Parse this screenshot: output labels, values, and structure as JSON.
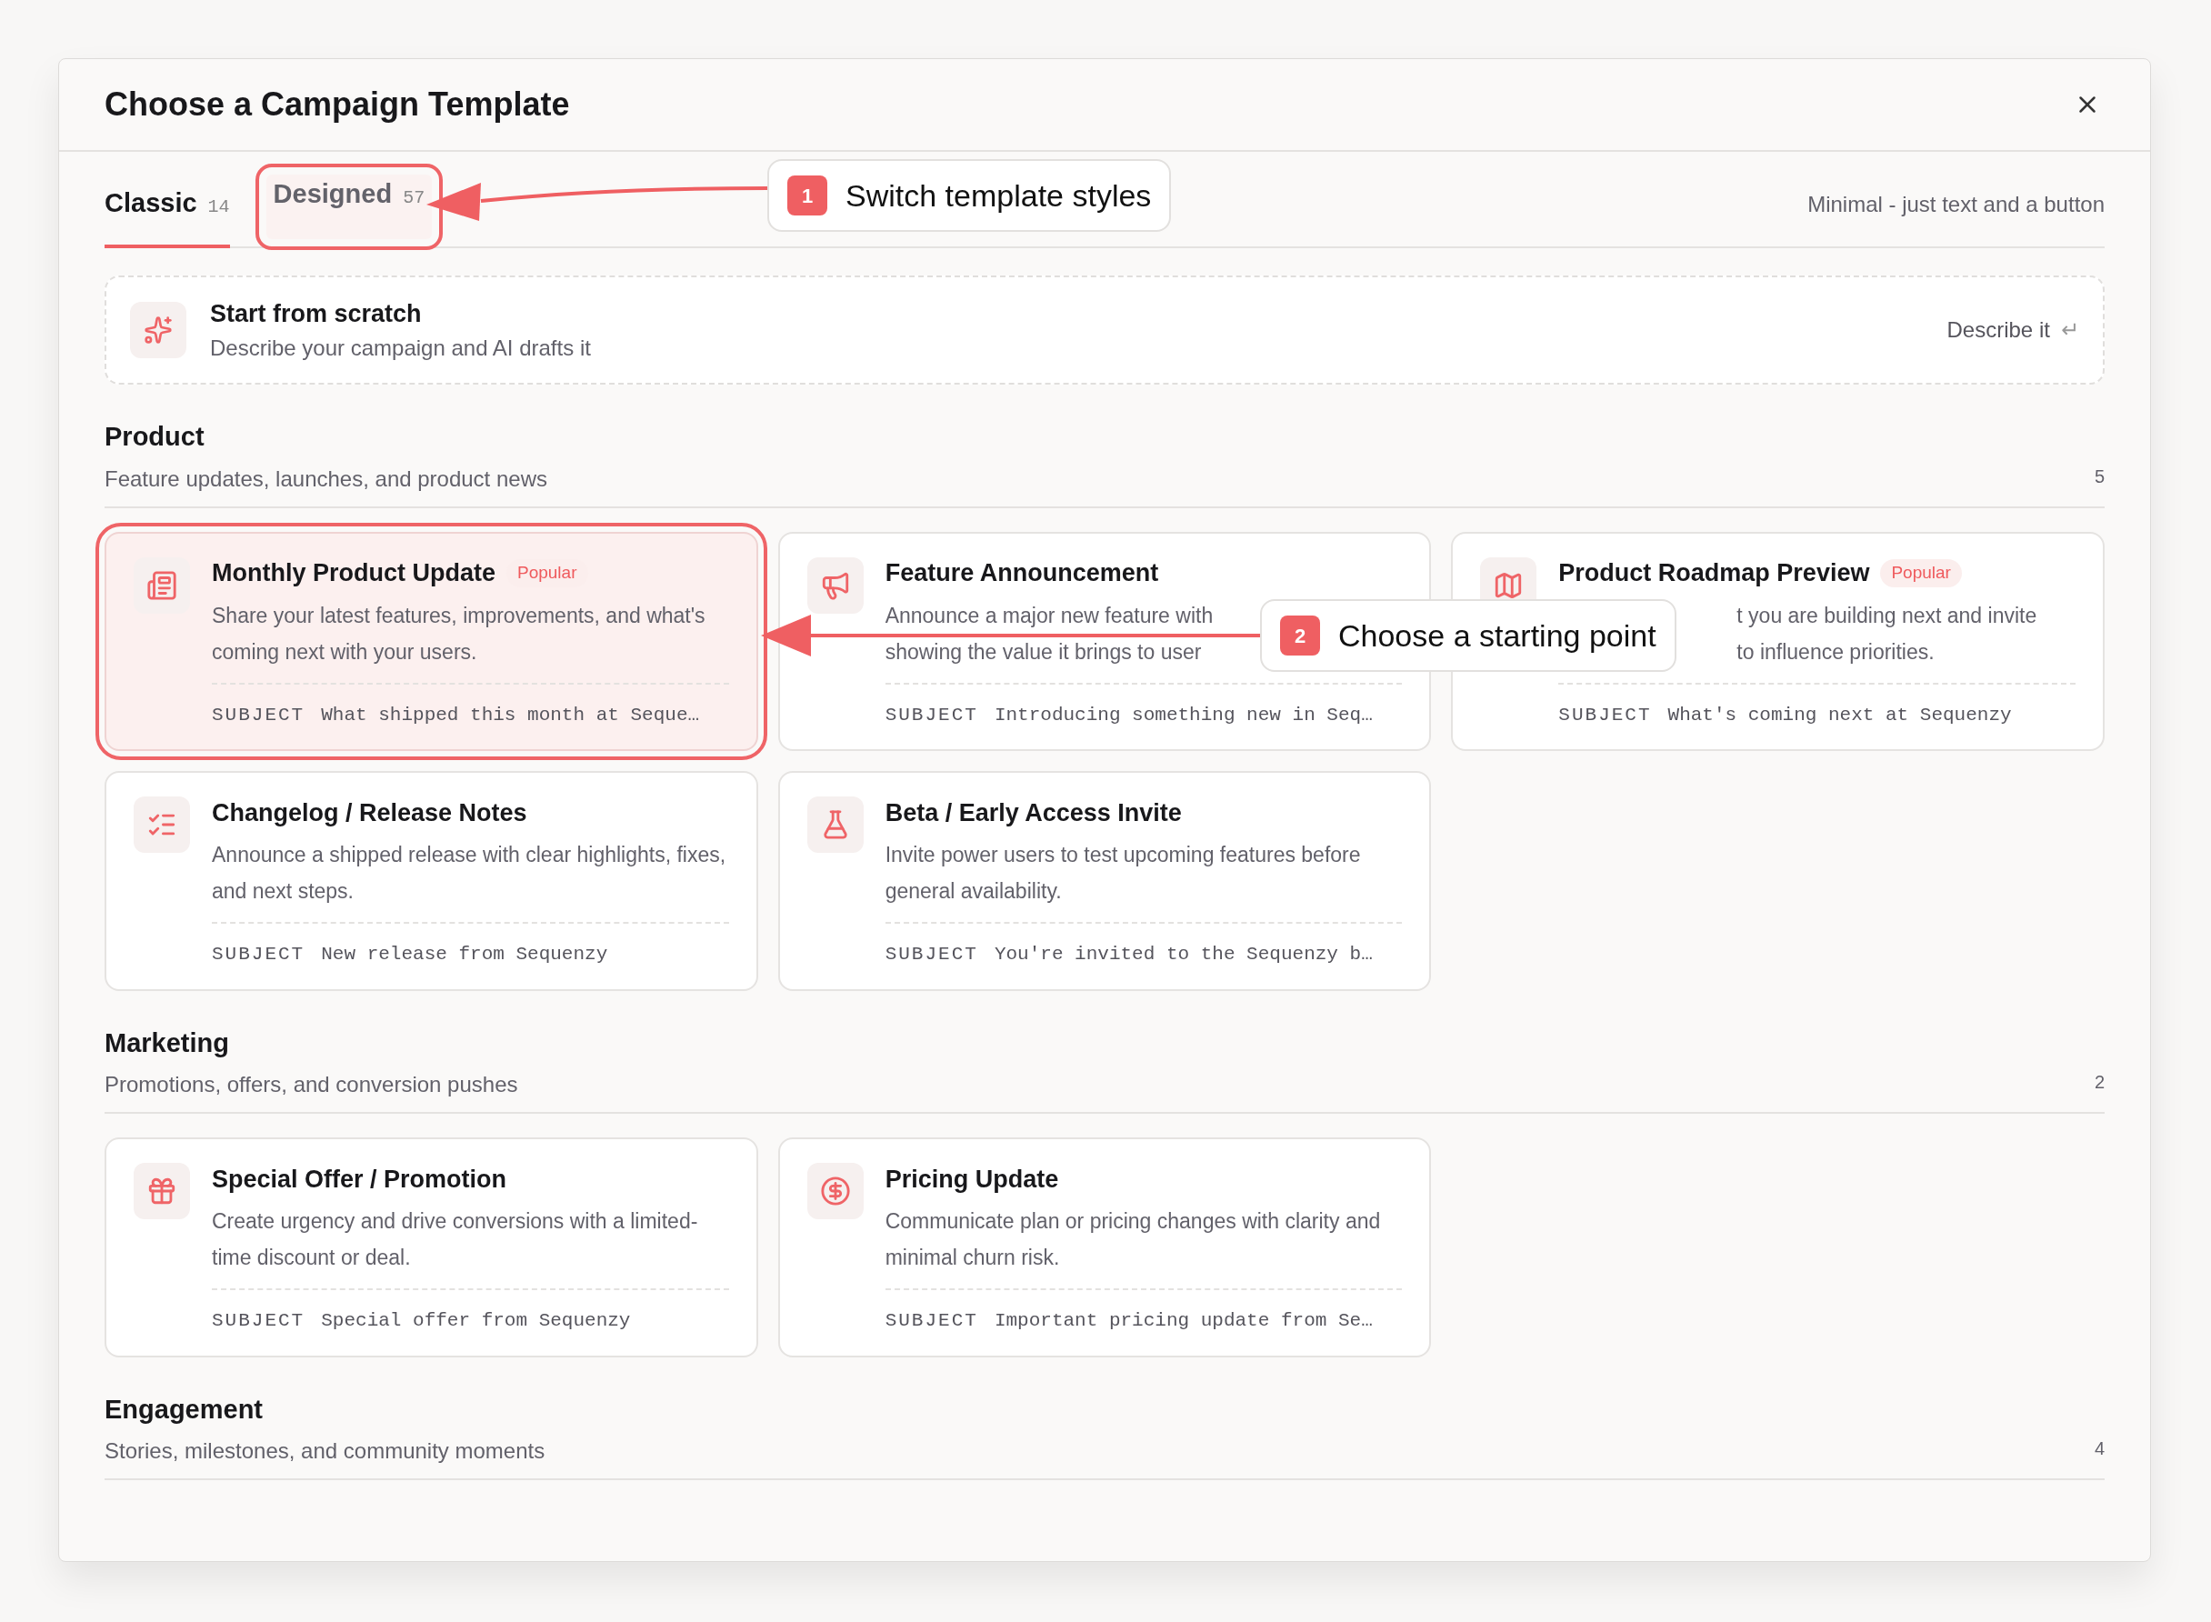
{
  "dialog": {
    "title": "Choose a Campaign Template"
  },
  "tabs": [
    {
      "label": "Classic",
      "count": "14",
      "selected": true,
      "annotated": false
    },
    {
      "label": "Designed",
      "count": "57",
      "selected": false,
      "annotated": true
    }
  ],
  "tab_hint": "Minimal - just text and a button",
  "scratch": {
    "title": "Start from scratch",
    "description": "Describe your campaign and AI drafts it",
    "action": "Describe it",
    "action_icon": "↵"
  },
  "sections": [
    {
      "title": "Product",
      "description": "Feature updates, launches, and product news",
      "count": "5",
      "cards": [
        {
          "title": "Monthly Product Update",
          "badge": "Popular",
          "lines": [
            "Share your latest features, improvements, and what's coming next with your users."
          ],
          "covered_start": false,
          "subject_label": "SUBJECT",
          "subject": "What shipped this month at Seque…",
          "selected": true,
          "annotated": true
        },
        {
          "title": "Feature Announcement",
          "lines": [
            "Announce a major new feature with",
            "showing the value it brings to user"
          ],
          "covered_start": false,
          "subject_label": "SUBJECT",
          "subject": "Introducing something new in Seq…",
          "selected": false,
          "annotated": false
        },
        {
          "title": "Product Roadmap Preview",
          "badge": "Popular",
          "lines": [
            "t you are building next and invite",
            "to influence priorities."
          ],
          "covered_start": true,
          "subject_label": "SUBJECT",
          "subject": "What's coming next at Sequenzy",
          "selected": false,
          "annotated": false
        },
        {
          "title": "Changelog / Release Notes",
          "lines": [
            "Announce a shipped release with clear highlights, fixes, and next steps."
          ],
          "covered_start": false,
          "subject_label": "SUBJECT",
          "subject": "New release from Sequenzy",
          "selected": false,
          "annotated": false
        },
        {
          "title": "Beta / Early Access Invite",
          "lines": [
            "Invite power users to test upcoming features before general availability."
          ],
          "covered_start": false,
          "subject_label": "SUBJECT",
          "subject": "You're invited to the Sequenzy b…",
          "selected": false,
          "annotated": false
        }
      ]
    },
    {
      "title": "Marketing",
      "description": "Promotions, offers, and conversion pushes",
      "count": "2",
      "cards": [
        {
          "title": "Special Offer / Promotion",
          "lines": [
            "Create urgency and drive conversions with a limited-time discount or deal."
          ],
          "covered_start": false,
          "subject_label": "SUBJECT",
          "subject": "Special offer from Sequenzy",
          "selected": false,
          "annotated": false
        },
        {
          "title": "Pricing Update",
          "lines": [
            "Communicate plan or pricing changes with clarity and minimal churn risk."
          ],
          "covered_start": false,
          "subject_label": "SUBJECT",
          "subject": "Important pricing update from Se…",
          "selected": false,
          "annotated": false
        }
      ]
    },
    {
      "title": "Engagement",
      "description": "Stories, milestones, and community moments",
      "count": "4"
    }
  ],
  "callouts": [
    {
      "number": "1",
      "text": "Switch template styles"
    },
    {
      "number": "2",
      "text": "Choose a starting point"
    }
  ]
}
